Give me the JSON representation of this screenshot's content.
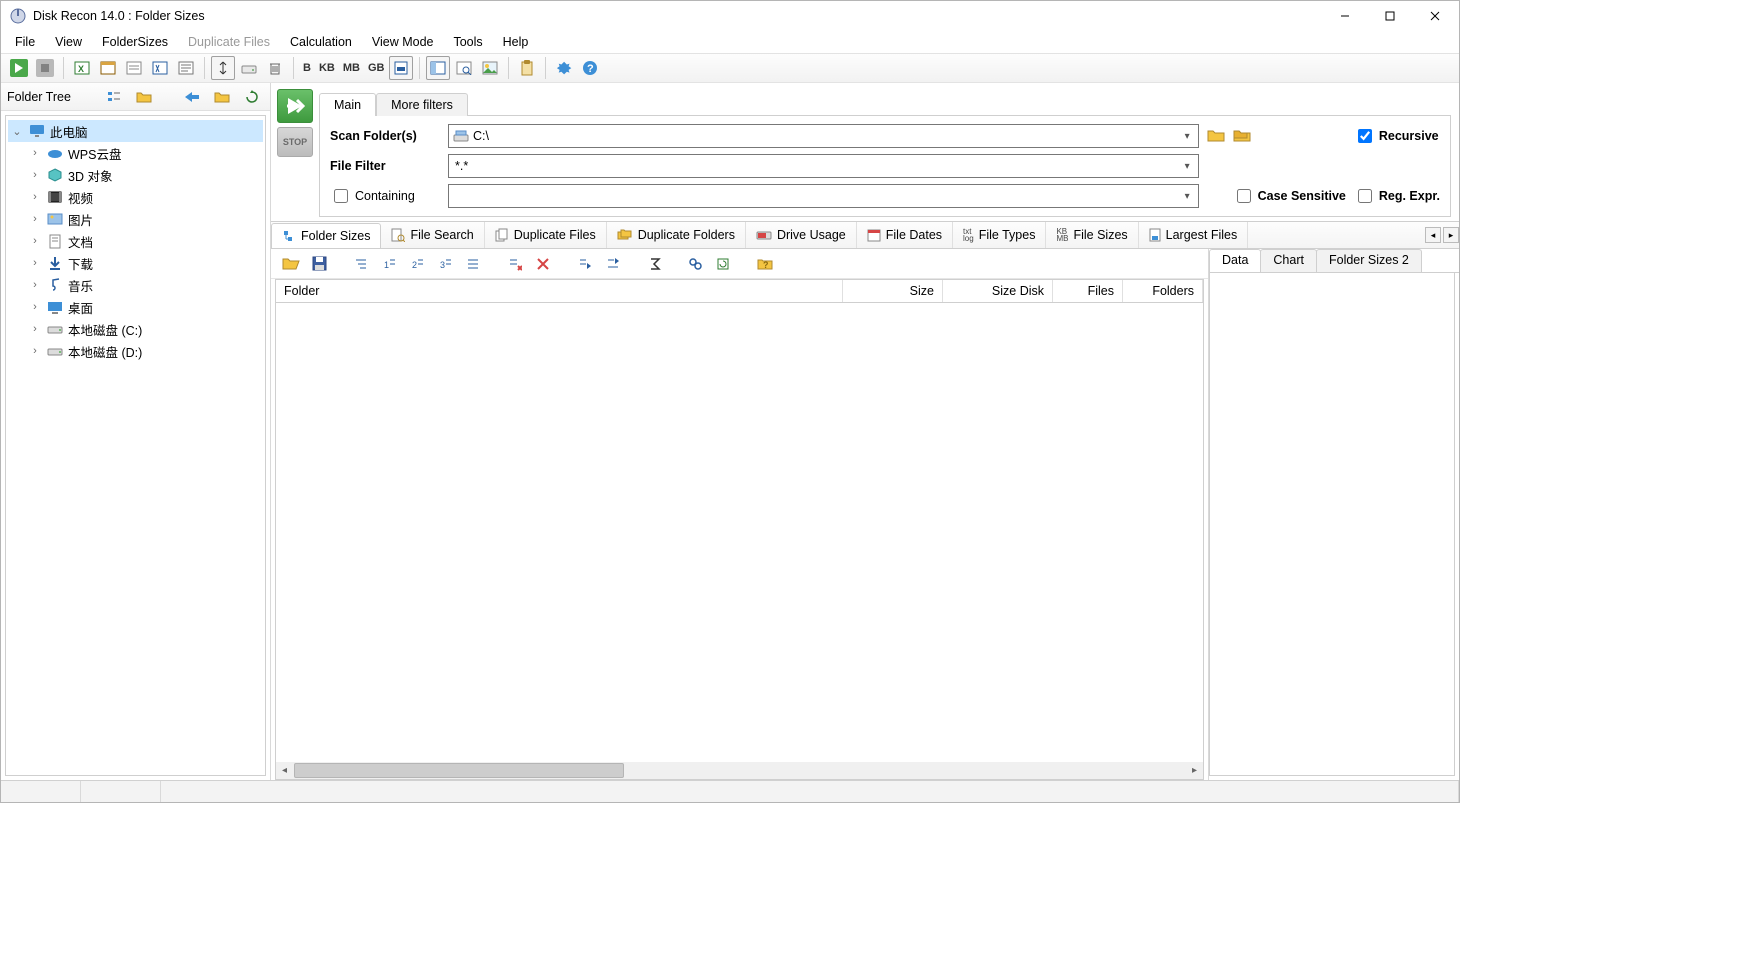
{
  "title": "Disk Recon 14.0 : Folder Sizes",
  "menu": [
    "File",
    "View",
    "FolderSizes",
    "Duplicate Files",
    "Calculation",
    "View Mode",
    "Tools",
    "Help"
  ],
  "menu_disabled": [
    3
  ],
  "unit_buttons": [
    "B",
    "KB",
    "MB",
    "GB"
  ],
  "left": {
    "header": "Folder Tree",
    "root": "此电脑",
    "items": [
      {
        "label": "WPS云盘",
        "icon": "cloud"
      },
      {
        "label": "3D 对象",
        "icon": "cube"
      },
      {
        "label": "视频",
        "icon": "video"
      },
      {
        "label": "图片",
        "icon": "image"
      },
      {
        "label": "文档",
        "icon": "doc"
      },
      {
        "label": "下载",
        "icon": "download"
      },
      {
        "label": "音乐",
        "icon": "music"
      },
      {
        "label": "桌面",
        "icon": "desktop"
      },
      {
        "label": "本地磁盘 (C:)",
        "icon": "drive"
      },
      {
        "label": "本地磁盘 (D:)",
        "icon": "drive"
      }
    ]
  },
  "scan": {
    "tab_main": "Main",
    "tab_more": "More filters",
    "scan_folders_label": "Scan Folder(s)",
    "scan_folders_value": "C:\\",
    "file_filter_label": "File Filter",
    "file_filter_value": "*.*",
    "containing_label": "Containing",
    "containing_value": "",
    "recursive_label": "Recursive",
    "case_label": "Case Sensitive",
    "regex_label": "Reg. Expr.",
    "stop_label": "STOP"
  },
  "modules": [
    "Folder Sizes",
    "File Search",
    "Duplicate Files",
    "Duplicate Folders",
    "Drive Usage",
    "File Dates",
    "File Types",
    "File Sizes",
    "Largest Files"
  ],
  "grid_columns": [
    "Folder",
    "Size",
    "Size Disk",
    "Files",
    "Folders"
  ],
  "side_tabs": [
    "Data",
    "Chart",
    "Folder Sizes 2"
  ]
}
